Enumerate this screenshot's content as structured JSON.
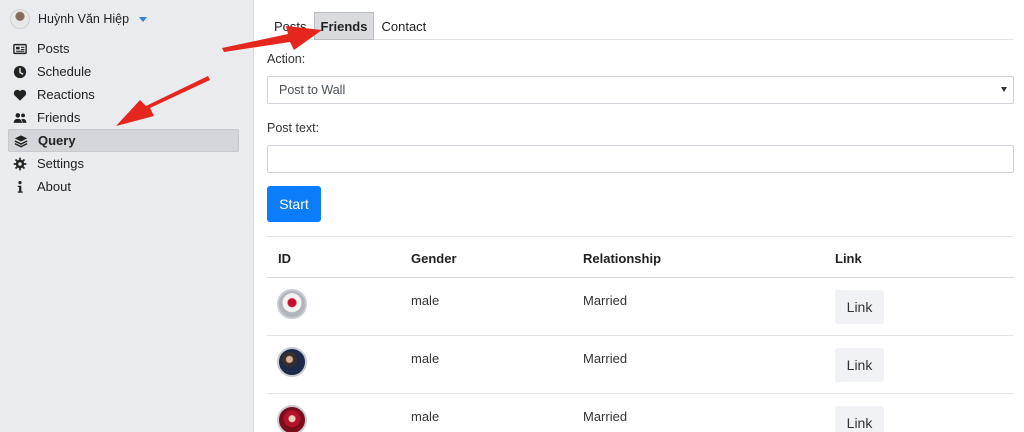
{
  "user": {
    "name": "Huỳnh Văn Hiệp"
  },
  "sidebar": {
    "items": [
      {
        "label": "Posts",
        "icon": "newspaper-icon"
      },
      {
        "label": "Schedule",
        "icon": "clock-icon"
      },
      {
        "label": "Reactions",
        "icon": "heart-icon"
      },
      {
        "label": "Friends",
        "icon": "users-icon"
      },
      {
        "label": "Query",
        "icon": "layers-icon",
        "active": true
      },
      {
        "label": "Settings",
        "icon": "gear-icon"
      },
      {
        "label": "About",
        "icon": "info-icon"
      }
    ]
  },
  "tabs": [
    {
      "label": "Posts"
    },
    {
      "label": "Friends",
      "active": true
    },
    {
      "label": "Contact"
    }
  ],
  "form": {
    "action_label": "Action:",
    "action_value": "Post to Wall",
    "post_text_label": "Post text:",
    "post_text_value": "",
    "start_label": "Start"
  },
  "table": {
    "headers": [
      "ID",
      "Gender",
      "Relationship",
      "Link"
    ],
    "rows": [
      {
        "gender": "male",
        "relationship": "Married",
        "link": "Link"
      },
      {
        "gender": "male",
        "relationship": "Married",
        "link": "Link"
      },
      {
        "gender": "male",
        "relationship": "Married",
        "link": "Link"
      }
    ]
  },
  "colors": {
    "accent": "#0b7dfb",
    "arrow": "#e5261e",
    "sidebar_bg": "#e9ebee"
  }
}
